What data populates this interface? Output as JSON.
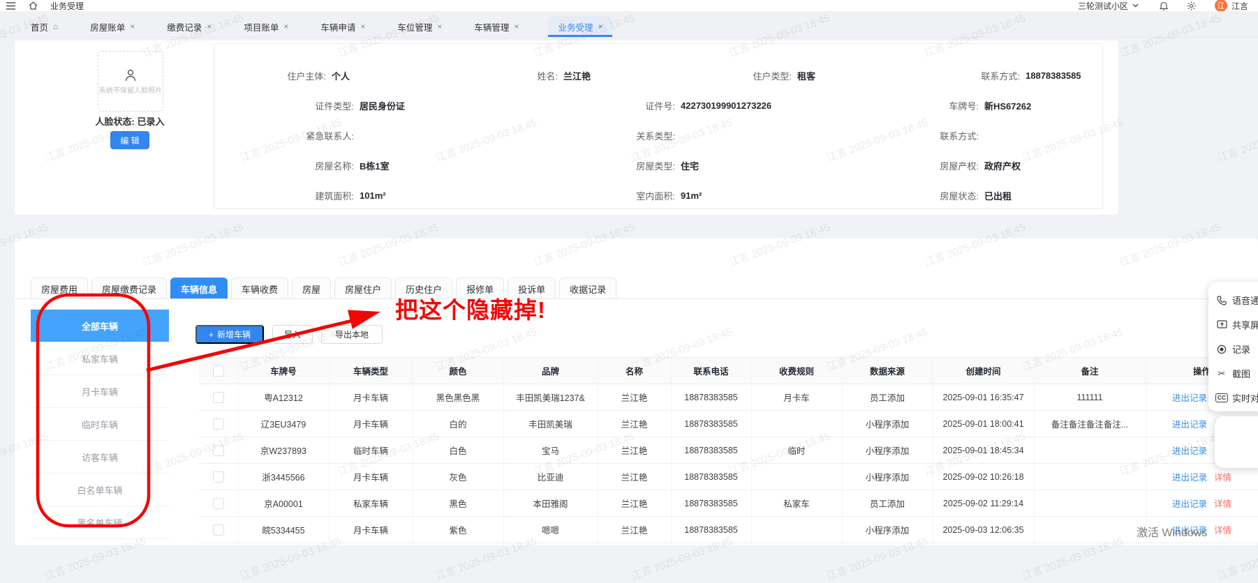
{
  "topbar": {
    "breadcrumb": "业务受理",
    "community": "三轮测试小区",
    "avatar_text": "江",
    "username": "江言"
  },
  "tab_strip": {
    "active": "业务受理",
    "tabs": [
      {
        "label": "首页",
        "home": true
      },
      {
        "label": "房屋账单",
        "closable": true
      },
      {
        "label": "缴费记录",
        "closable": true
      },
      {
        "label": "项目账单",
        "closable": true
      },
      {
        "label": "车辆申请",
        "closable": true
      },
      {
        "label": "车位管理",
        "closable": true
      },
      {
        "label": "车辆管理",
        "closable": true
      },
      {
        "label": "业务受理",
        "closable": true,
        "active": true
      }
    ]
  },
  "resident": {
    "face_placeholder": "系统不保留人脸照片",
    "face_status": "人脸状态: 已录入",
    "edit_button": "编 辑",
    "row1": [
      {
        "label": "住户主体:",
        "value": "个人"
      },
      {
        "label": "姓名:",
        "value": "兰江艳"
      },
      {
        "label": "住户类型:",
        "value": "租客"
      },
      {
        "label": "联系方式:",
        "value": "18878383585"
      }
    ],
    "rows": [
      [
        {
          "label": "证件类型:",
          "value": "居民身份证"
        },
        {
          "label": "证件号:",
          "value": "422730199901273226"
        },
        {
          "label": "车牌号:",
          "value": "新HS67262"
        }
      ],
      [
        {
          "label": "紧急联系人:",
          "value": ""
        },
        {
          "label": "关系类型:",
          "value": ""
        },
        {
          "label": "联系方式:",
          "value": ""
        }
      ],
      [
        {
          "label": "房屋名称:",
          "value": "B栋1室"
        },
        {
          "label": "房屋类型:",
          "value": "住宅"
        },
        {
          "label": "房屋产权:",
          "value": "政府产权"
        }
      ],
      [
        {
          "label": "建筑面积:",
          "value": "101m²"
        },
        {
          "label": "室内面积:",
          "value": "91m²"
        },
        {
          "label": "房屋状态:",
          "value": "已出租"
        }
      ]
    ]
  },
  "section_tabs": {
    "active": "车辆信息",
    "tabs": [
      "房屋费用",
      "房屋缴费记录",
      "车辆信息",
      "车辆收费",
      "房屋",
      "房屋住户",
      "历史住户",
      "报修单",
      "投诉单",
      "收据记录"
    ]
  },
  "vehicle_nav": {
    "active": "全部车辆",
    "items": [
      "全部车辆",
      "私家车辆",
      "月卡车辆",
      "临时车辆",
      "访客车辆",
      "白名单车辆",
      "黑名单车辆"
    ]
  },
  "toolbar": {
    "add": "新增车辆",
    "import": "导入",
    "export": "导出本地"
  },
  "vehicle_table": {
    "columns": [
      "车牌号",
      "车辆类型",
      "颜色",
      "品牌",
      "名称",
      "联系电话",
      "收费规则",
      "数据来源",
      "创建时间",
      "备注",
      "操作"
    ],
    "row_actions": [
      "进出记录",
      "详情"
    ],
    "rows": [
      {
        "plate": "粤A12312",
        "type": "月卡车辆",
        "color": "黑色黑色黑",
        "brand": "丰田凯美瑞1237&",
        "name": "兰江艳",
        "phone": "18878383585",
        "rule": "月卡车",
        "source": "员工添加",
        "created": "2025-09-01 16:35:47",
        "remark": "111111"
      },
      {
        "plate": "辽3EU3479",
        "type": "月卡车辆",
        "color": "白的",
        "brand": "丰田凯美瑞",
        "name": "兰江艳",
        "phone": "18878383585",
        "rule": "",
        "source": "小程序添加",
        "created": "2025-09-01 18:00:41",
        "remark": "备注备注备注备注..."
      },
      {
        "plate": "京W237893",
        "type": "临时车辆",
        "color": "白色",
        "brand": "宝马",
        "name": "兰江艳",
        "phone": "18878383585",
        "rule": "临时",
        "source": "小程序添加",
        "created": "2025-09-01 18:45:34",
        "remark": ""
      },
      {
        "plate": "浙3445566",
        "type": "月卡车辆",
        "color": "灰色",
        "brand": "比亚迪",
        "name": "兰江艳",
        "phone": "18878383585",
        "rule": "",
        "source": "小程序添加",
        "created": "2025-09-02 10:26:18",
        "remark": ""
      },
      {
        "plate": "京A00001",
        "type": "私家车辆",
        "color": "黑色",
        "brand": "本田雅阁",
        "name": "兰江艳",
        "phone": "18878383585",
        "rule": "私家车",
        "source": "员工添加",
        "created": "2025-09-02 11:29:14",
        "remark": ""
      },
      {
        "plate": "皖5334455",
        "type": "月卡车辆",
        "color": "紫色",
        "brand": "嗯嗯",
        "name": "兰江艳",
        "phone": "18878383585",
        "rule": "",
        "source": "小程序添加",
        "created": "2025-09-03 12:06:35",
        "remark": ""
      },
      {
        "plate": "",
        "type": "",
        "color": "",
        "brand": "",
        "name": "",
        "phone": "",
        "rule": "",
        "source": "",
        "created": "",
        "remark": "",
        "partial": true
      }
    ]
  },
  "quick_panel": {
    "items": [
      {
        "icon": "phone-icon",
        "label": "语音通"
      },
      {
        "icon": "share-screen-icon",
        "label": "共享屏"
      },
      {
        "icon": "record-icon",
        "label": "记录"
      },
      {
        "icon": "screenshot-icon",
        "label": "截图"
      },
      {
        "icon": "cc-icon",
        "label": "实时对"
      }
    ]
  },
  "annotation": {
    "text": "把这个隐藏掉!"
  },
  "watermark": {
    "text": "江言 2025-09-03 18:45"
  },
  "os_activation": {
    "line1": "激活 Windows"
  },
  "colors": {
    "accent": "#3286f0",
    "link_blue": "#3a8ee6",
    "danger_red": "#f56c6c",
    "annotation_red": "#f40606",
    "sidebar_active": "#44a3fc",
    "avatar_orange": "#f77234"
  }
}
